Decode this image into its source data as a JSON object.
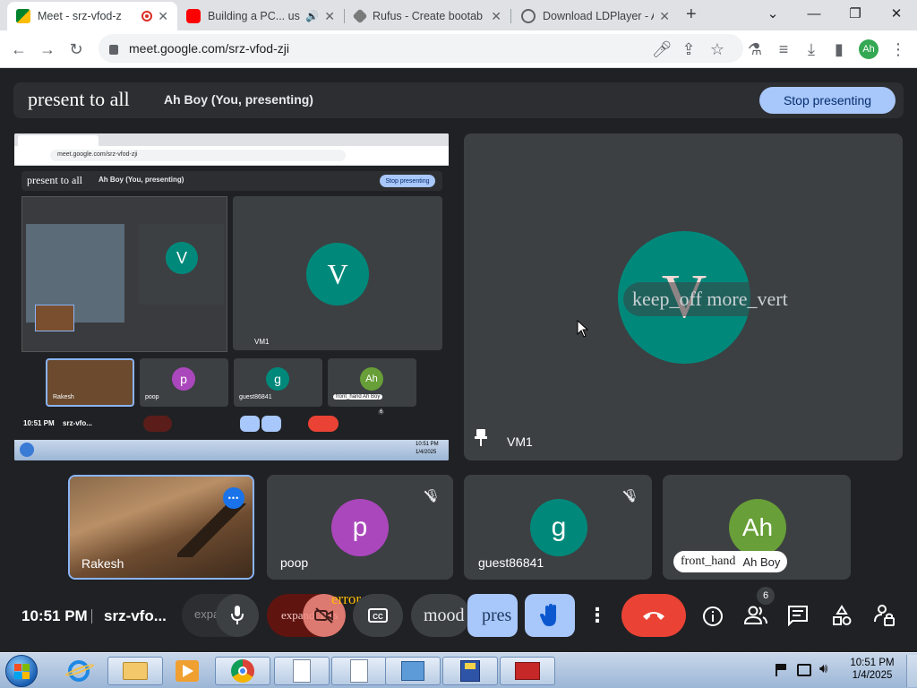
{
  "browser": {
    "tabs": [
      {
        "title": "Meet - srz-vfod-z",
        "active": true
      },
      {
        "title": "Building a PC... us",
        "active": false
      },
      {
        "title": "Rufus - Create bootab",
        "active": false
      },
      {
        "title": "Download LDPlayer - A",
        "active": false
      }
    ],
    "url": "meet.google.com/srz-vfod-zji",
    "profile_initials": "Ah"
  },
  "meet": {
    "presenting_title": "present to all",
    "presenting_who": "Ah Boy (You, presenting)",
    "stop_presenting_label": "Stop presenting",
    "main_tile": {
      "name": "VM1",
      "avatar_letter": "V",
      "avatar_color": "#00897b",
      "overlay_text": "keep_off more_vert"
    },
    "participants": [
      {
        "name": "Rakesh",
        "type": "video",
        "more_label": "•••"
      },
      {
        "name": "poop",
        "letter": "p",
        "color": "#ab47bc",
        "muted": true
      },
      {
        "name": "guest86841",
        "letter": "g",
        "color": "#00897b",
        "muted": true
      },
      {
        "name": "Ah Boy",
        "letter": "Ah",
        "color": "#689f38",
        "hand_label": "front_hand"
      }
    ],
    "preview": {
      "title": "present to all",
      "who": "Ah Boy (You, presenting)",
      "stop": "Stop presenting",
      "url": "meet.google.com/srz-vfod-zji",
      "tile_name": "VM1",
      "time": "10:51 PM",
      "code": "srz-vfo...",
      "names": [
        "Rakesh",
        "poop",
        "guest86841"
      ],
      "hand": "front_hand",
      "hand_name": "Ah Boy",
      "badge": "6",
      "tray_time": "10:51 PM",
      "tray_date": "1/4/2025"
    },
    "controls": {
      "time": "10:51 PM",
      "meeting_code": "srz-vfo...",
      "expand_label": "expa",
      "camera_error_label": "error",
      "camera_expand_label": "expand_less",
      "mood_label": "mood",
      "present_label": "pres",
      "people_badge": "6"
    }
  },
  "taskbar": {
    "time": "10:51 PM",
    "date": "1/4/2025"
  },
  "colors": {
    "meet_bg": "#202124",
    "tile_bg": "#3c4043",
    "accent_blue": "#a8c7fa",
    "end_call_red": "#ea4335"
  }
}
